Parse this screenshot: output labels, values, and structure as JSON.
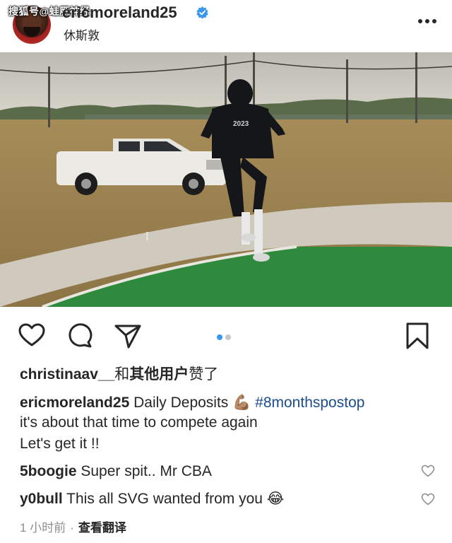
{
  "watermark": "搜狐号@蛙厥神经",
  "post": {
    "username": "ericmoreland25",
    "location": "休斯敦",
    "more_icon": "more-horizontal-icon"
  },
  "photo": {
    "shirt_text": "2023",
    "carousel": {
      "count": 2,
      "active_index": 0
    }
  },
  "actions": {
    "icons": [
      "heart-icon",
      "comment-icon",
      "share-icon",
      "bookmark-icon"
    ]
  },
  "likes": {
    "user": "christinaav__",
    "suffix_plain": "和",
    "suffix_bold": "其他用户",
    "suffix_end": "赞了"
  },
  "caption": {
    "username": "ericmoreland25",
    "line1_text": "Daily Deposits",
    "emoji": "💪🏽",
    "hashtag": "#8monthspostop",
    "line2": "it's about that time to compete again",
    "line3": "Let's get it !!"
  },
  "comments": [
    {
      "username": "5boogie",
      "text": "Super spit.. Mr CBA"
    },
    {
      "username": "y0bull",
      "text": "This all SVG wanted from you",
      "emoji": "😂"
    }
  ],
  "meta": {
    "time": "1 小时前",
    "separator": "·",
    "translate": "查看翻译"
  },
  "colors": {
    "verified": "#3897f0",
    "hashtag": "#1a4d8c",
    "carousel_active": "#3897f0",
    "turf": "#2f8a3e"
  }
}
